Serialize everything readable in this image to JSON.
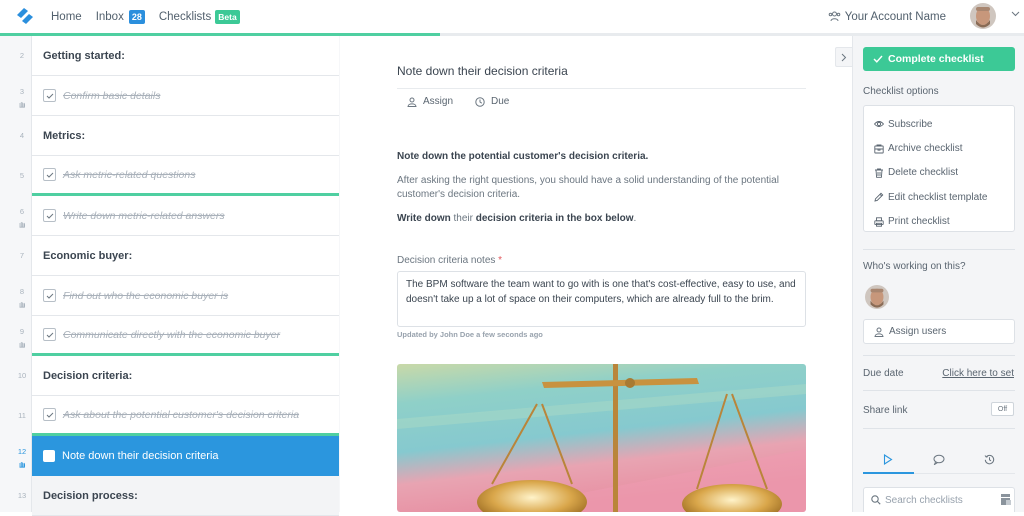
{
  "topbar": {
    "nav": [
      {
        "label": "Home"
      },
      {
        "label": "Inbox",
        "badge": "28"
      },
      {
        "label": "Checklists",
        "badge": "Beta"
      }
    ],
    "account_name": "Your Account Name"
  },
  "progress": {
    "percent": 43,
    "color": "#4fcfa1"
  },
  "tasks": [
    {
      "num": "2",
      "label": "Getting started:",
      "type": "heading",
      "done": false,
      "hand": false
    },
    {
      "num": "3",
      "label": "Confirm basic details",
      "type": "task",
      "done": true,
      "hand": true
    },
    {
      "num": "4",
      "label": "Metrics:",
      "type": "heading",
      "done": false,
      "hand": false
    },
    {
      "num": "5",
      "label": "Ask metric-related questions",
      "type": "task",
      "done": true,
      "hand": false,
      "stop_after": true
    },
    {
      "num": "6",
      "label": "Write down metric-related answers",
      "type": "task",
      "done": true,
      "hand": true
    },
    {
      "num": "7",
      "label": "Economic buyer:",
      "type": "heading",
      "done": false,
      "hand": false
    },
    {
      "num": "8",
      "label": "Find out who the economic buyer is",
      "type": "task",
      "done": true,
      "hand": true
    },
    {
      "num": "9",
      "label": "Communicate directly with the economic buyer",
      "type": "task",
      "done": true,
      "hand": true,
      "stop_after": true
    },
    {
      "num": "10",
      "label": "Decision criteria:",
      "type": "heading",
      "done": false,
      "hand": false
    },
    {
      "num": "11",
      "label": "Ask about the potential customer's decision criteria",
      "type": "task",
      "done": true,
      "hand": false,
      "stop_after": true
    },
    {
      "num": "12",
      "label": "Note down their decision criteria",
      "type": "task",
      "done": false,
      "hand": true,
      "active": true
    },
    {
      "num": "13",
      "label": "Decision process:",
      "type": "heading",
      "done": false,
      "hand": false,
      "next": true
    }
  ],
  "main": {
    "title": "Note down their decision criteria",
    "assign_label": "Assign",
    "due_label": "Due",
    "body_heading": "Note down the potential customer's decision criteria.",
    "body_paragraph": "After asking the right questions, you should have a solid understanding of the potential customer's decision criteria.",
    "body_instruction": {
      "part1": "Write down",
      "part2": " their ",
      "part3": "decision criteria in the box below",
      "part4": "."
    },
    "field_label": "Decision criteria notes",
    "field_required": "*",
    "field_value": "The BPM software the team want to go with is one that's cost-effective, easy to use, and doesn't take up a lot of space on their computers, which are already full to the brim.",
    "updated_text": "Updated by John Doe a few seconds ago",
    "image_alt": "brass scales of justice"
  },
  "sidebar": {
    "complete_label": "Complete checklist",
    "options_label": "Checklist options",
    "options": [
      {
        "icon": "eye-icon",
        "label": "Subscribe"
      },
      {
        "icon": "archive-icon",
        "label": "Archive checklist"
      },
      {
        "icon": "trash-icon",
        "label": "Delete checklist"
      },
      {
        "icon": "pencil-icon",
        "label": "Edit checklist template"
      },
      {
        "icon": "printer-icon",
        "label": "Print checklist"
      }
    ],
    "who_label": "Who's working on this?",
    "assign_users_label": "Assign users",
    "due_date_label": "Due date",
    "due_date_link": "Click here to set",
    "share_link_label": "Share link",
    "share_toggle": "Off",
    "search_placeholder": "Search checklists"
  }
}
